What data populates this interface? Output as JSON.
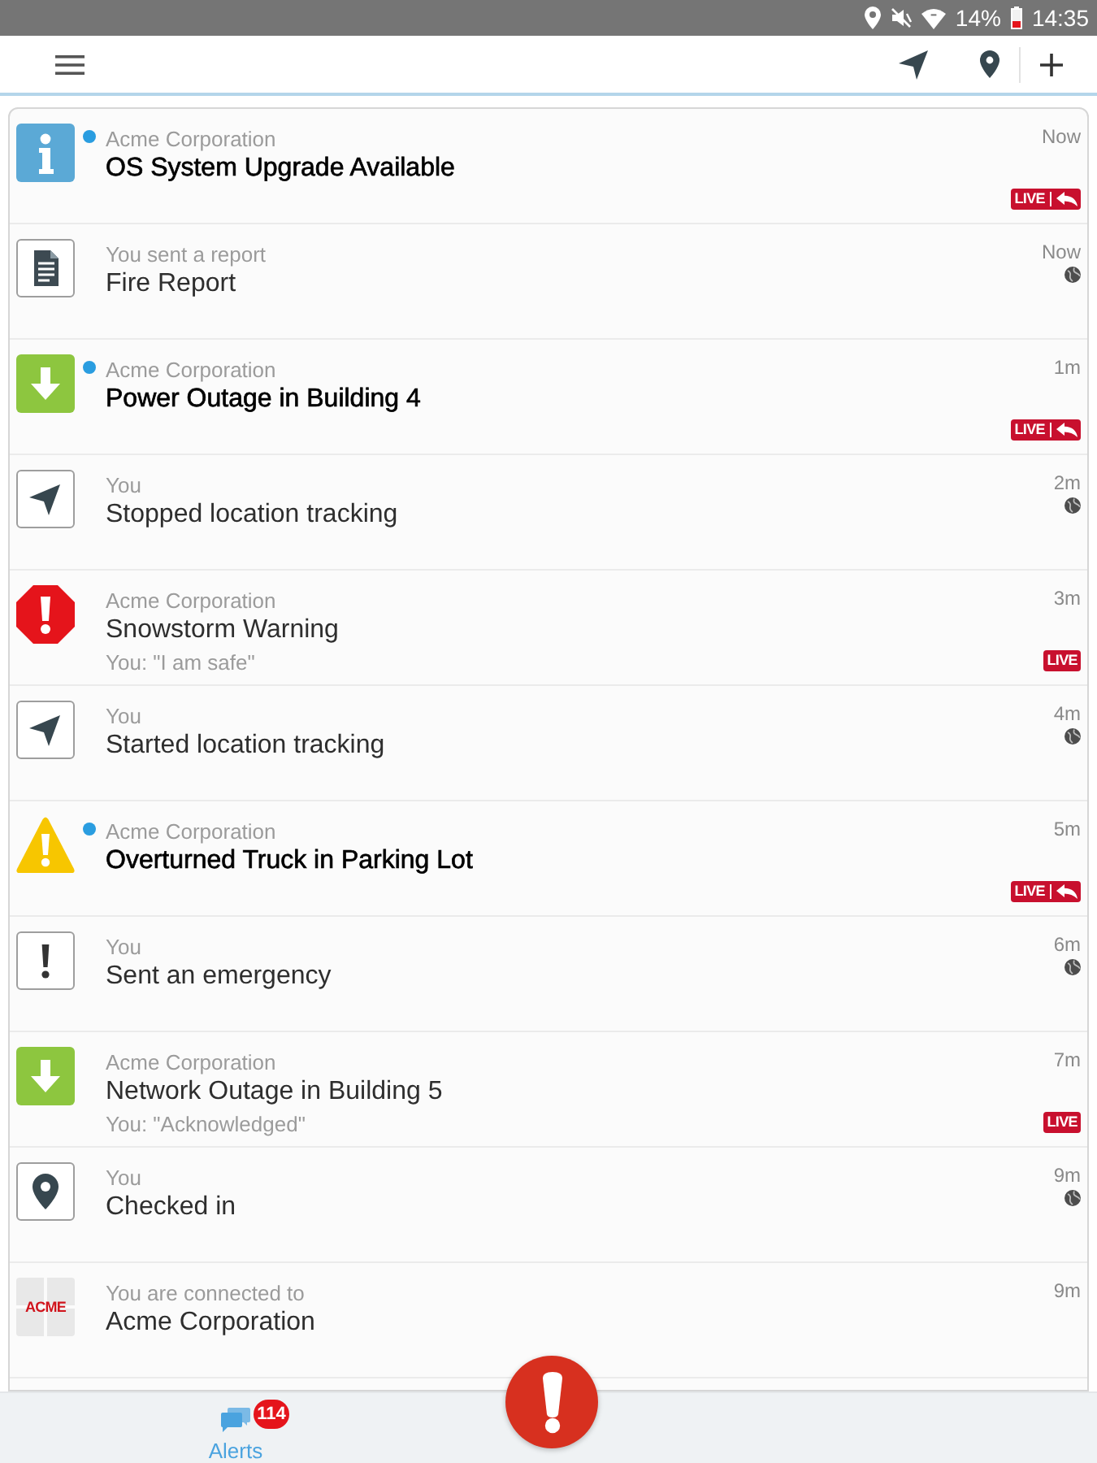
{
  "status_bar": {
    "battery": "14%",
    "time": "14:35"
  },
  "alerts": [
    {
      "kind": "info",
      "unread": true,
      "sender": "Acme Corporation",
      "title": "OS System Upgrade Available",
      "time": "Now",
      "globe": false,
      "live_badge": {
        "label": "LIVE",
        "reply": true
      }
    },
    {
      "kind": "report",
      "unread": false,
      "sender": "You sent a report",
      "title": "Fire Report",
      "time": "Now",
      "globe": true
    },
    {
      "kind": "download",
      "unread": true,
      "sender": "Acme Corporation",
      "title": "Power Outage in Building 4",
      "time": "1m",
      "globe": false,
      "live_badge": {
        "label": "LIVE",
        "reply": true
      }
    },
    {
      "kind": "navigation",
      "unread": false,
      "sender": "You",
      "title": "Stopped location tracking",
      "time": "2m",
      "globe": true
    },
    {
      "kind": "stop",
      "unread": false,
      "sender": "Acme Corporation",
      "title": "Snowstorm Warning",
      "response": "You: \"I am safe\"",
      "time": "3m",
      "globe": false,
      "live_badge": {
        "label": "LIVE",
        "reply": false
      }
    },
    {
      "kind": "navigation",
      "unread": false,
      "sender": "You",
      "title": "Started location tracking",
      "time": "4m",
      "globe": true
    },
    {
      "kind": "warning",
      "unread": true,
      "sender": "Acme Corporation",
      "title": "Overturned Truck in Parking Lot",
      "time": "5m",
      "globe": false,
      "live_badge": {
        "label": "LIVE",
        "reply": true
      }
    },
    {
      "kind": "emergency",
      "unread": false,
      "sender": "You",
      "title": "Sent an emergency",
      "time": "6m",
      "globe": true
    },
    {
      "kind": "download",
      "unread": false,
      "sender": "Acme Corporation",
      "title": "Network Outage in Building 5",
      "response": "You: \"Acknowledged\"",
      "time": "7m",
      "globe": false,
      "live_badge": {
        "label": "LIVE",
        "reply": false
      }
    },
    {
      "kind": "pin",
      "unread": false,
      "sender": "You",
      "title": "Checked in",
      "time": "9m",
      "globe": true
    },
    {
      "kind": "logo",
      "logo_text": "ACME",
      "unread": false,
      "sender": "You are connected to",
      "title": "Acme Corporation",
      "time": "9m",
      "globe": false
    }
  ],
  "tabs": [
    {
      "label": "Alerts",
      "count": "114",
      "selected": true
    }
  ]
}
